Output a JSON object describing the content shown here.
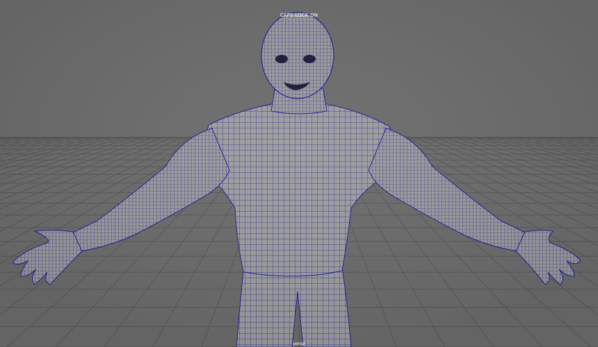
{
  "viewport": {
    "caps_lock_indicator": "CAPS LOCK ON",
    "bottom_label": "persp",
    "background_color": "#6b6b6b",
    "grid_color": "#555555",
    "mesh_fill_color": "#9c9c9e",
    "wireframe_color": "#1f1f8f"
  },
  "scene": {
    "object": "human body base mesh",
    "display_mode": "wireframe on shaded",
    "pose": "T-pose"
  }
}
